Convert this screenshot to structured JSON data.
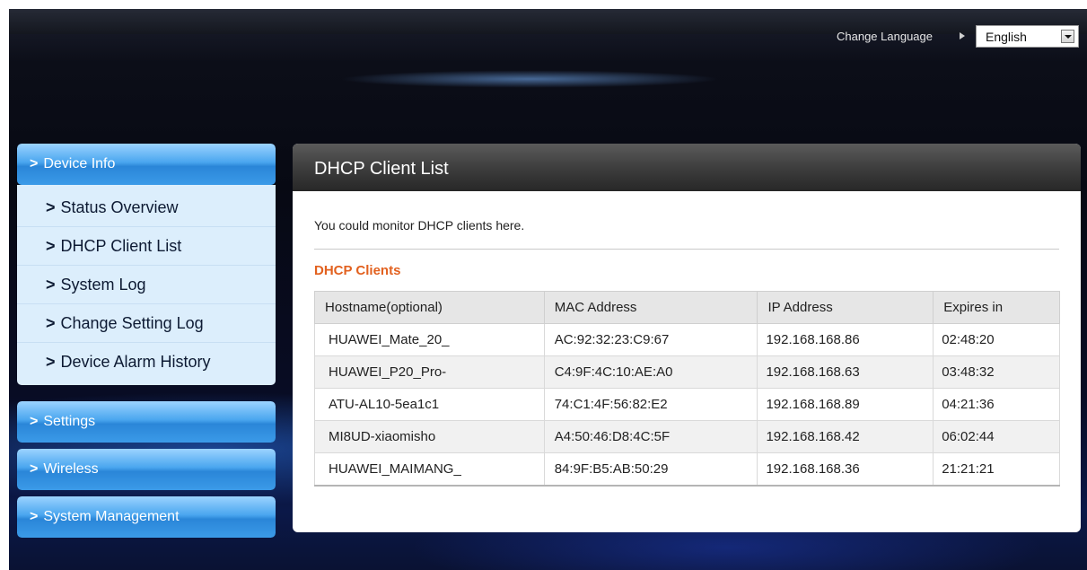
{
  "header": {
    "change_language_label": "Change Language",
    "language_selected": "English"
  },
  "sidebar": {
    "device_info": {
      "label": "Device Info",
      "items": [
        {
          "label": "Status Overview"
        },
        {
          "label": "DHCP Client List"
        },
        {
          "label": "System Log"
        },
        {
          "label": "Change Setting Log"
        },
        {
          "label": "Device Alarm History"
        }
      ]
    },
    "settings_label": "Settings",
    "wireless_label": "Wireless",
    "system_management_label": "System Management",
    "chevron": ">"
  },
  "main": {
    "title": "DHCP Client List",
    "description": "You could monitor DHCP clients here.",
    "section_title": "DHCP Clients",
    "table": {
      "columns": [
        "Hostname(optional)",
        "MAC Address",
        "IP Address",
        "Expires in"
      ],
      "rows": [
        [
          "HUAWEI_Mate_20_",
          "AC:92:32:23:C9:67",
          "192.168.168.86",
          "02:48:20"
        ],
        [
          "HUAWEI_P20_Pro-",
          "C4:9F:4C:10:AE:A0",
          "192.168.168.63",
          "03:48:32"
        ],
        [
          "ATU-AL10-5ea1c1",
          "74:C1:4F:56:82:E2",
          "192.168.168.89",
          "04:21:36"
        ],
        [
          "MI8UD-xiaomisho",
          "A4:50:46:D8:4C:5F",
          "192.168.168.42",
          "06:02:44"
        ],
        [
          "HUAWEI_MAIMANG_",
          "84:9F:B5:AB:50:29",
          "192.168.168.36",
          "21:21:21"
        ]
      ]
    }
  },
  "colors": {
    "accent_orange": "#e2611f",
    "nav_blue": "#2a86d8",
    "nav_sub_bg": "#dceefc"
  }
}
